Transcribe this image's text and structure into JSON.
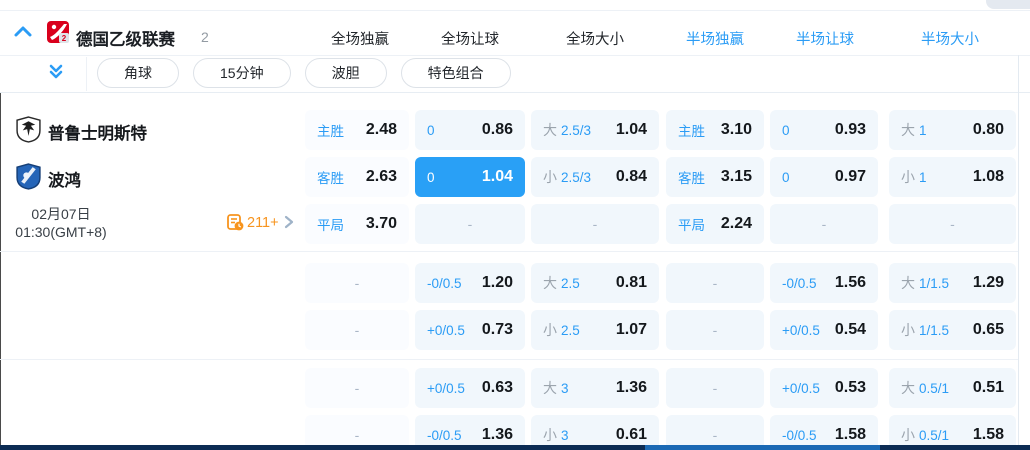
{
  "colors": {
    "accent_blue": "#2b9cf5",
    "selected_cell_bg": "#29a0f6",
    "orange": "#f7941e",
    "scrollbar_track": "#0c2c54",
    "scrollbar_thumb": "#1b69b4",
    "league_logo_red": "#d9001c",
    "away_logo_blue": "#2565b8"
  },
  "icons": {
    "collapse": "chevron-up",
    "expand_more": "double-chevron-down",
    "more_markets": "coupon-clock",
    "more_arrow": "chevron-right"
  },
  "header": {
    "league": {
      "name": "德国乙级联赛",
      "count": "2"
    },
    "tabs": [
      {
        "label": "全场独赢",
        "active": false
      },
      {
        "label": "全场让球",
        "active": false
      },
      {
        "label": "全场大小",
        "active": false
      },
      {
        "label": "半场独赢",
        "active": true
      },
      {
        "label": "半场让球",
        "active": true
      },
      {
        "label": "半场大小",
        "active": true
      }
    ]
  },
  "filters": [
    "角球",
    "15分钟",
    "波胆",
    "特色组合"
  ],
  "match": {
    "home_team": "普鲁士明斯特",
    "away_team": "波鸿",
    "date": "02月07日",
    "time": "01:30(GMT+8)",
    "more_markets": "211+"
  },
  "odds": {
    "rows": [
      [
        {
          "blue": "主胜",
          "value": "2.48"
        },
        {
          "blue": "0",
          "value": "0.86"
        },
        {
          "grey": "大",
          "blue": "2.5/3",
          "value": "1.04"
        },
        {
          "blue": "主胜",
          "value": "3.10"
        },
        {
          "blue": "0",
          "value": "0.93"
        },
        {
          "grey": "大",
          "blue": "1",
          "value": "0.80"
        }
      ],
      [
        {
          "blue": "客胜",
          "value": "2.63"
        },
        {
          "blue": "0",
          "value": "1.04",
          "selected": true
        },
        {
          "grey": "小",
          "blue": "2.5/3",
          "value": "0.84"
        },
        {
          "blue": "客胜",
          "value": "3.15"
        },
        {
          "blue": "0",
          "value": "0.97"
        },
        {
          "grey": "小",
          "blue": "1",
          "value": "1.08"
        }
      ],
      [
        {
          "blue": "平局",
          "value": "3.70"
        },
        {
          "dash": true
        },
        {
          "dash": true
        },
        {
          "blue": "平局",
          "value": "2.24"
        },
        {
          "dash": true
        },
        {
          "dash": true
        }
      ],
      [
        {
          "dash": true
        },
        {
          "blue": "-0/0.5",
          "value": "1.20"
        },
        {
          "grey": "大",
          "blue": "2.5",
          "value": "0.81"
        },
        {
          "dash": true
        },
        {
          "blue": "-0/0.5",
          "value": "1.56"
        },
        {
          "grey": "大",
          "blue": "1/1.5",
          "value": "1.29"
        }
      ],
      [
        {
          "dash": true
        },
        {
          "blue": "+0/0.5",
          "value": "0.73"
        },
        {
          "grey": "小",
          "blue": "2.5",
          "value": "1.07"
        },
        {
          "dash": true
        },
        {
          "blue": "+0/0.5",
          "value": "0.54"
        },
        {
          "grey": "小",
          "blue": "1/1.5",
          "value": "0.65"
        }
      ],
      [
        {
          "dash": true
        },
        {
          "blue": "+0/0.5",
          "value": "0.63"
        },
        {
          "grey": "大",
          "blue": "3",
          "value": "1.36"
        },
        {
          "dash": true
        },
        {
          "blue": "+0/0.5",
          "value": "0.53"
        },
        {
          "grey": "大",
          "blue": "0.5/1",
          "value": "0.51"
        }
      ],
      [
        {
          "dash": true
        },
        {
          "blue": "-0/0.5",
          "value": "1.36"
        },
        {
          "grey": "小",
          "blue": "3",
          "value": "0.61"
        },
        {
          "dash": true
        },
        {
          "blue": "-0/0.5",
          "value": "1.58"
        },
        {
          "grey": "小",
          "blue": "0.5/1",
          "value": "1.58"
        }
      ]
    ]
  }
}
